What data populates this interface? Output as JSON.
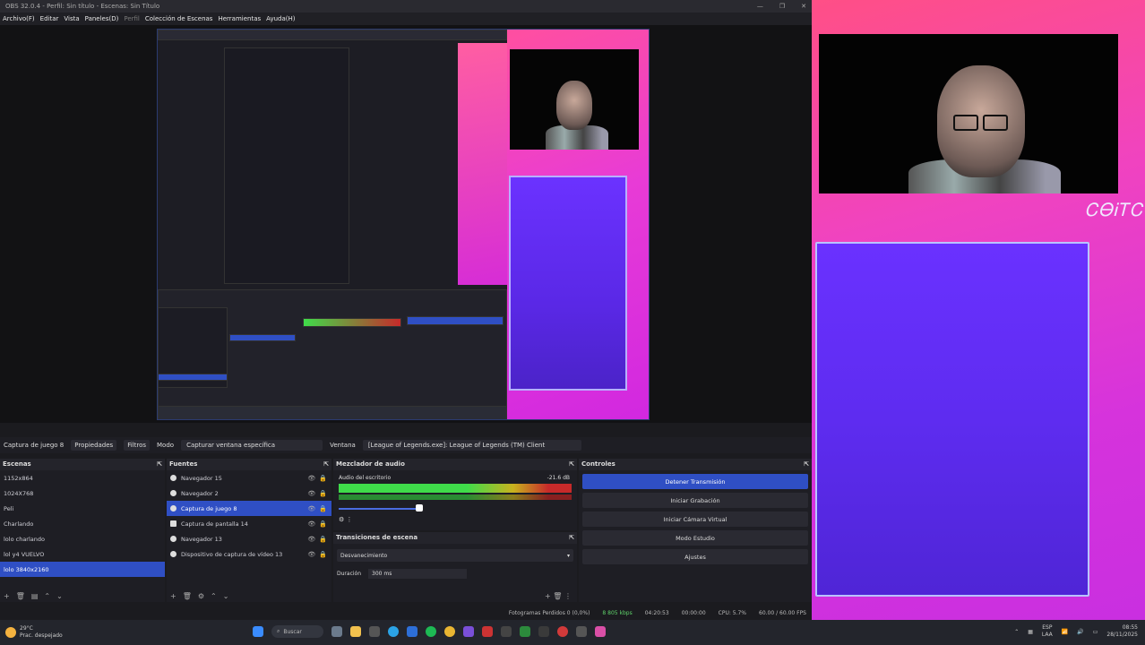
{
  "window": {
    "title": "OBS 32.0.4 - Perfil: Sin título - Escenas: Sin Título",
    "controls": [
      "—",
      "❐",
      "✕"
    ]
  },
  "menu": [
    "Archivo(F)",
    "Editar",
    "Vista",
    "Paneles(D)",
    "Perfil",
    "Colección de Escenas",
    "Herramientas",
    "Ayuda(H)"
  ],
  "source_toolbar": {
    "source_name": "Captura de juego 8",
    "properties": "Propiedades",
    "filters": "Filtros",
    "mode_label": "Modo",
    "mode_value": "Capturar ventana específica",
    "window_label": "Ventana",
    "window_value": "[League of Legends.exe]: League of Legends (TM) Client"
  },
  "scenes": {
    "title": "Escenas",
    "items": [
      "1152x864",
      "1024X768",
      "Peli",
      "Charlando",
      "lolo charlando",
      "lol y4 VUELVO",
      "lolo 3840x2160"
    ],
    "active_index": 6
  },
  "sources": {
    "title": "Fuentes",
    "items": [
      "Navegador 15",
      "Navegador 2",
      "Captura de juego 8",
      "Captura de pantalla 14",
      "Navegador 13",
      "Dispositivo de captura de vídeo 13"
    ],
    "active_index": 2
  },
  "mixer": {
    "title": "Mezclador de audio",
    "channel": "Audio del escritorio",
    "level": "-21.6 dB"
  },
  "transitions": {
    "title": "Transiciones de escena",
    "value": "Desvanecimiento",
    "duration_label": "Duración",
    "duration_value": "300 ms"
  },
  "controls": {
    "title": "Controles",
    "buttons": [
      "Detener Transmisión",
      "Iniciar Grabación",
      "Iniciar Cámara Virtual",
      "Modo Estudio",
      "Ajustes"
    ]
  },
  "status": {
    "dropped": "Fotogramas Perdidos 0 (0,0%)",
    "kbps": "8 805 kbps",
    "stream_time": "04:20:53",
    "rec_time": "00:00:00",
    "cpu": "CPU: 5.7%",
    "fps": "60.00 / 60.00 FPS"
  },
  "stream_logo": "ᏟᎾᎥᎢᏟ",
  "taskbar": {
    "temp": "29°C",
    "weather": "Prac. despejado",
    "search": "Buscar",
    "lang": "ESP",
    "lang2": "LAA",
    "time": "08:55",
    "date": "28/11/2025"
  },
  "colors": {
    "accent": "#2f4fc4",
    "overlay_pink": "#ff4f86",
    "overlay_purple": "#6a31ff"
  }
}
